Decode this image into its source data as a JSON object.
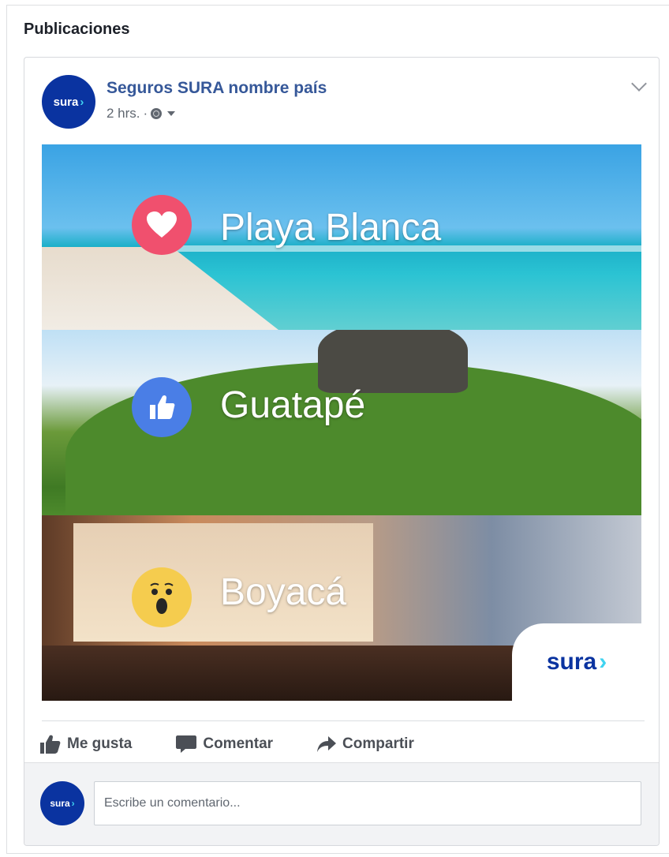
{
  "section": {
    "title": "Publicaciones"
  },
  "post": {
    "page_name": "Seguros SURA nombre país",
    "time": "2 hrs.",
    "separator": "·",
    "avatar_text": "sura",
    "destinations": [
      {
        "label": "Playa Blanca",
        "reaction": "love-icon"
      },
      {
        "label": "Guatapé",
        "reaction": "like-icon"
      },
      {
        "label": "Boyacá",
        "reaction": "wow-icon"
      }
    ],
    "logo_text": "sura"
  },
  "actions": {
    "like_label": "Me gusta",
    "comment_label": "Comentar",
    "share_label": "Compartir"
  },
  "comment": {
    "placeholder": "Escribe un comentario..."
  },
  "colors": {
    "brand": "#0a33a0",
    "brand_accent": "#3fd3f0",
    "link": "#365899",
    "love": "#f0506e",
    "like": "#4a7ee6",
    "wow": "#f5cc4e"
  }
}
